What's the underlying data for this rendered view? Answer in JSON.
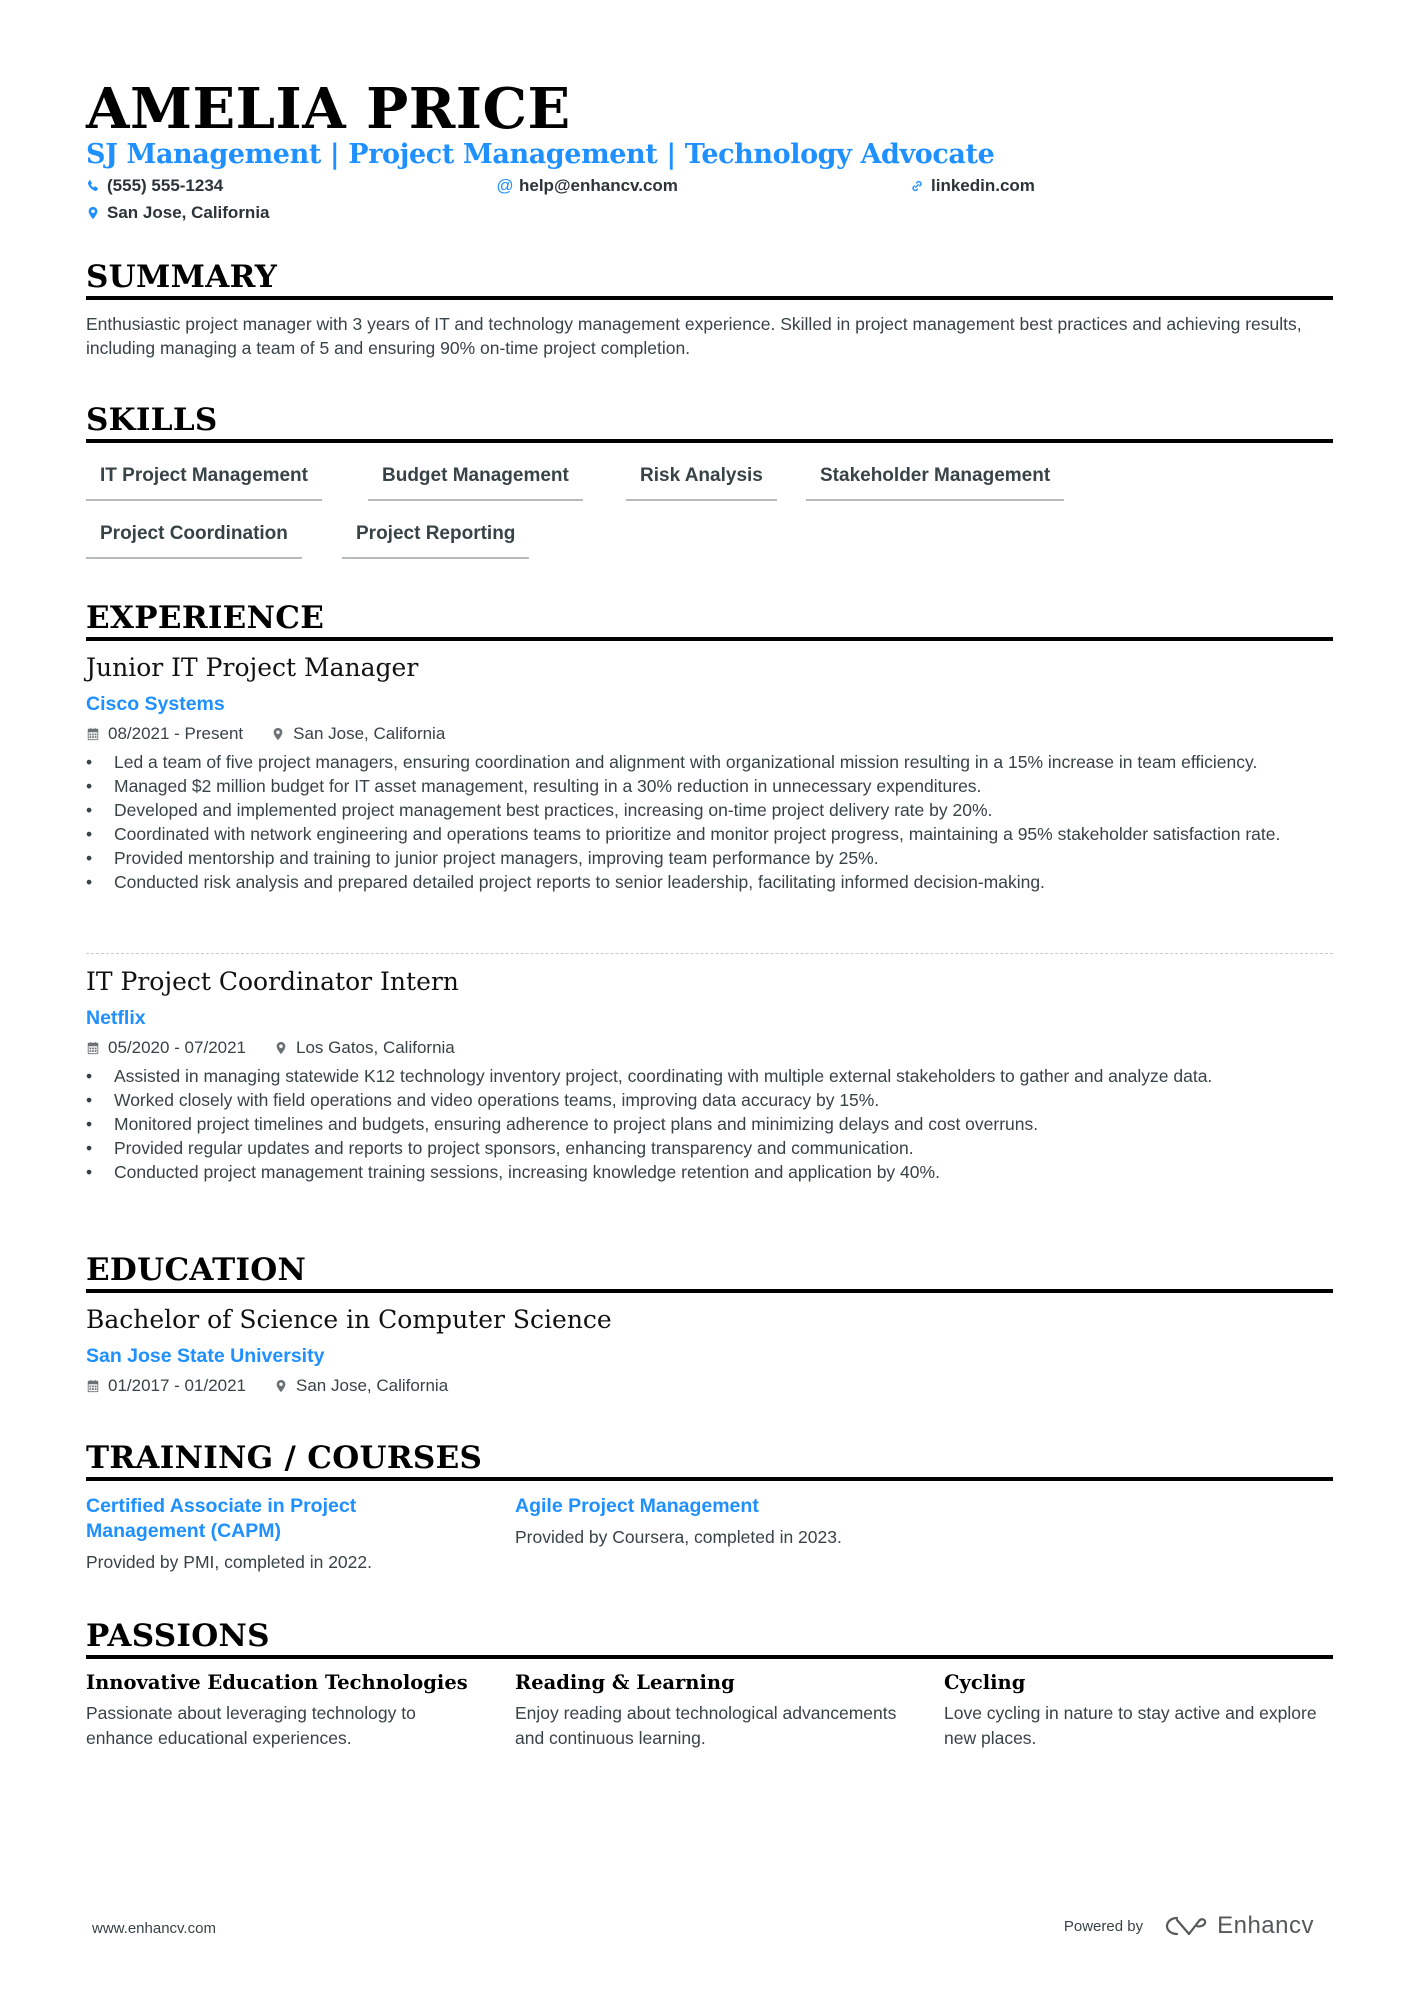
{
  "header": {
    "name": "AMELIA PRICE",
    "tagline": "SJ Management | Project Management | Technology Advocate",
    "contacts": {
      "phone": {
        "icon": "phone-icon",
        "value": "(555) 555-1234"
      },
      "email": {
        "icon": "at-icon",
        "value": "help@enhancv.com"
      },
      "link": {
        "icon": "link-icon",
        "value": "linkedin.com"
      },
      "location": {
        "icon": "map-pin-icon",
        "value": "San Jose, California"
      }
    }
  },
  "colors": {
    "accent": "#1e90ff",
    "text": "#384347",
    "heading": "#000000"
  },
  "summary": {
    "title": "SUMMARY",
    "text": "Enthusiastic project manager with 3 years of IT and technology management experience. Skilled in project management best practices and achieving results, including managing a team of 5 and ensuring 90% on-time project completion."
  },
  "skills": {
    "title": "SKILLS",
    "items": [
      "IT Project Management",
      "Budget Management",
      "Risk Analysis",
      "Stakeholder Management",
      "Project Coordination",
      "Project Reporting"
    ]
  },
  "experience": {
    "title": "EXPERIENCE",
    "jobs": [
      {
        "title": "Junior IT Project Manager",
        "company": "Cisco Systems",
        "dates": "08/2021 - Present",
        "location": "San Jose, California",
        "bullets": [
          "Led a team of five project managers, ensuring coordination and alignment with organizational mission resulting in a 15% increase in team efficiency.",
          "Managed $2 million budget for IT asset management, resulting in a 30% reduction in unnecessary expenditures.",
          "Developed and implemented project management best practices, increasing on-time project delivery rate by 20%.",
          "Coordinated with network engineering and operations teams to prioritize and monitor project progress, maintaining a 95% stakeholder satisfaction rate.",
          "Provided mentorship and training to junior project managers, improving team performance by 25%.",
          "Conducted risk analysis and prepared detailed project reports to senior leadership, facilitating informed decision-making."
        ]
      },
      {
        "title": "IT Project Coordinator Intern",
        "company": "Netflix",
        "dates": "05/2020 - 07/2021",
        "location": "Los Gatos, California",
        "bullets": [
          "Assisted in managing statewide K12 technology inventory project, coordinating with multiple external stakeholders to gather and analyze data.",
          "Worked closely with field operations and video operations teams, improving data accuracy by 15%.",
          "Monitored project timelines and budgets, ensuring adherence to project plans and minimizing delays and cost overruns.",
          "Provided regular updates and reports to project sponsors, enhancing transparency and communication.",
          "Conducted project management training sessions, increasing knowledge retention and application by 40%."
        ]
      }
    ]
  },
  "education": {
    "title": "EDUCATION",
    "items": [
      {
        "degree": "Bachelor of Science in Computer Science",
        "school": "San Jose State University",
        "dates": "01/2017 - 01/2021",
        "location": "San Jose, California"
      }
    ]
  },
  "training": {
    "title": "TRAINING / COURSES",
    "items": [
      {
        "title": "Certified Associate in Project Management (CAPM)",
        "desc": "Provided by PMI, completed in 2022."
      },
      {
        "title": "Agile Project Management",
        "desc": "Provided by Coursera, completed in 2023."
      }
    ]
  },
  "passions": {
    "title": "PASSIONS",
    "items": [
      {
        "title": "Innovative Education Technologies",
        "desc": "Passionate about leveraging technology to enhance educational experiences."
      },
      {
        "title": "Reading & Learning",
        "desc": "Enjoy reading about technological advancements and continuous learning."
      },
      {
        "title": "Cycling",
        "desc": "Love cycling in nature to stay active and explore new places."
      }
    ]
  },
  "footer": {
    "website": "www.enhancv.com",
    "powered_by": "Powered by",
    "brand": "Enhancv"
  }
}
